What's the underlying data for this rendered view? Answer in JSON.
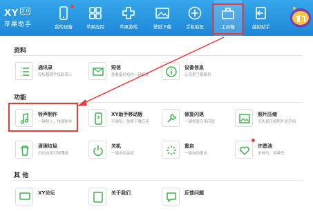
{
  "app": {
    "logo": "XY",
    "version": "2.0",
    "subtitle": "苹果助手"
  },
  "nav": [
    {
      "label": "我的设备",
      "icon": "phone-icon"
    },
    {
      "label": "苹果应用",
      "icon": "apps-icon"
    },
    {
      "label": "苹果游戏",
      "icon": "gamepad-icon"
    },
    {
      "label": "壁纸下载",
      "icon": "picture-icon"
    },
    {
      "label": "手机助役",
      "icon": "plus-circle-icon"
    },
    {
      "label": "工具箱",
      "icon": "toolbox-icon"
    },
    {
      "label": "越狱助手",
      "icon": "exit-icon"
    }
  ],
  "sections": {
    "data_title": "资料",
    "function_title": "功能",
    "other_title": "其 他"
  },
  "data_cards": [
    {
      "title": "通讯录",
      "desc": "轻松管理手机联系人",
      "icon": "contacts-list-icon"
    },
    {
      "title": "短信",
      "desc": "查看备份短信一键搞定",
      "icon": "message-icon"
    },
    {
      "title": "设备信息",
      "desc": "让您更了解着机",
      "icon": "device-info-icon"
    }
  ],
  "function_cards": [
    {
      "title": "铃声制作",
      "desc": "一键导入，快速制作",
      "icon": "music-note-icon"
    },
    {
      "title": "XY助手移动版",
      "desc": "不越狱，免费下载应用",
      "icon": "mobile-icon"
    },
    {
      "title": "修复闪退",
      "desc": "一键修复应用闪退",
      "icon": "wrench-icon"
    },
    {
      "title": "照片压缩",
      "desc": "无失真压缩照片省空间",
      "icon": "photo-icon"
    },
    {
      "title": "清理垃圾",
      "desc": "扫出垃圾可清理掉",
      "icon": "trash-icon"
    },
    {
      "title": "关机",
      "desc": "一键自动关机",
      "icon": "power-icon"
    },
    {
      "title": "重启",
      "desc": "一键自动重启",
      "icon": "restart-icon"
    },
    {
      "title": "许愿池",
      "desc": "求神马，得神马",
      "icon": "heart-icon"
    }
  ],
  "other_cards": [
    {
      "title": "XY论坛",
      "icon": "chat-icon"
    },
    {
      "title": "关于我们",
      "icon": "info-icon"
    },
    {
      "title": "反馈问题",
      "icon": "feedback-icon"
    }
  ],
  "colors": {
    "topbar": "#2a97e2",
    "accent": "#1e87d6",
    "highlight": "#e83a3a",
    "icon_green": "#3db44b"
  }
}
